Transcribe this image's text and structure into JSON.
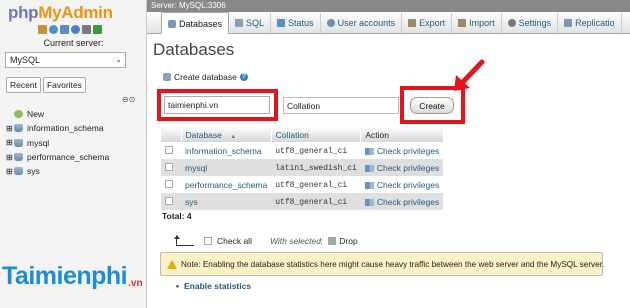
{
  "app": {
    "logo_php": "php",
    "logo_myadmin": "MyAdmin",
    "current_server_label": "Current server:",
    "current_server_value": "MySQL"
  },
  "left_panel": {
    "tabs": [
      "Recent",
      "Favorites"
    ],
    "link_icon_text": "⊖⊙",
    "tree": [
      {
        "label": "New",
        "expander": ""
      },
      {
        "label": "information_schema",
        "expander": "⊞"
      },
      {
        "label": "mysql",
        "expander": "⊞"
      },
      {
        "label": "performance_schema",
        "expander": "⊞"
      },
      {
        "label": "sys",
        "expander": "⊞"
      }
    ]
  },
  "topbar": {
    "server_crumb": "Server: MySQL:3306"
  },
  "tabs": [
    {
      "label": "Databases",
      "icon": "database-icon",
      "active": true
    },
    {
      "label": "SQL",
      "icon": "sql-icon",
      "active": false
    },
    {
      "label": "Status",
      "icon": "status-icon",
      "active": false
    },
    {
      "label": "User accounts",
      "icon": "users-icon",
      "active": false
    },
    {
      "label": "Export",
      "icon": "export-icon",
      "active": false
    },
    {
      "label": "Import",
      "icon": "import-icon",
      "active": false
    },
    {
      "label": "Settings",
      "icon": "settings-icon",
      "active": false
    },
    {
      "label": "Replicatio",
      "icon": "replication-icon",
      "active": false
    }
  ],
  "main": {
    "title": "Databases",
    "create_db_label": "Create database",
    "db_name_value": "taimienphi.vn",
    "collation_placeholder": "Collation",
    "create_button": "Create",
    "table": {
      "headers": {
        "database": "Database",
        "sort": "▲",
        "collation": "Collation",
        "action": "Action"
      },
      "rows": [
        {
          "name": "information_schema",
          "collation": "utf8_general_ci",
          "action": "Check privileges"
        },
        {
          "name": "mysql",
          "collation": "latin1_swedish_ci",
          "action": "Check privileges"
        },
        {
          "name": "performance_schema",
          "collation": "utf8_general_ci",
          "action": "Check privileges"
        },
        {
          "name": "sys",
          "collation": "utf8_general_ci",
          "action": "Check privileges"
        }
      ],
      "total": "Total: 4"
    },
    "bulk": {
      "check_all": "Check all",
      "with_selected": "With selected:",
      "drop": "Drop"
    },
    "notice": "Note: Enabling the database statistics here might cause heavy traffic between the web server and the MySQL server.",
    "enable_stats": "Enable statistics"
  },
  "watermark": {
    "main": "Taimienphi",
    "suffix": ".vn"
  },
  "colors": {
    "accent_red": "#e3141a",
    "link_blue": "#235a81",
    "notice_bg": "#fbf1c6"
  }
}
